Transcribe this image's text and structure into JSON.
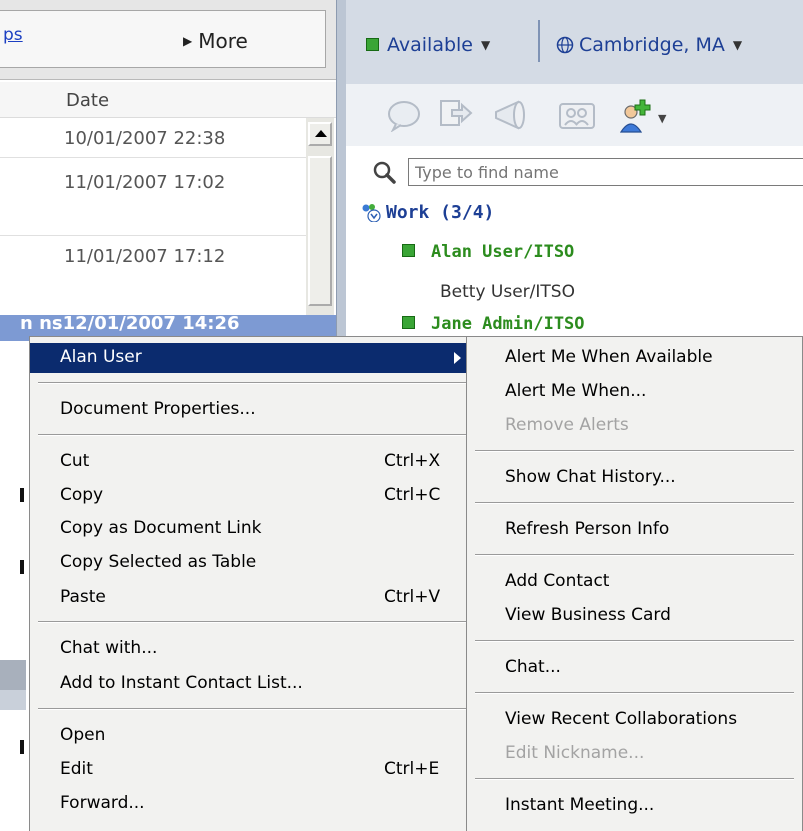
{
  "left_pane": {
    "toolbar_link": "ps",
    "more_label": "More",
    "column_header": "Date",
    "rows": [
      "10/01/2007 22:38",
      "11/01/2007 17:02",
      "11/01/2007 17:12"
    ],
    "selected_row": "n ns12/01/2007 14:26"
  },
  "right_pane": {
    "status": "Available",
    "location": "Cambridge, MA",
    "search_placeholder": "Type to find name",
    "group": "Work (3/4)",
    "contacts": [
      {
        "name": "Alan User/ITSO",
        "online": true
      },
      {
        "name": "Betty User/ITSO",
        "online": false
      },
      {
        "name": "Jane Admin/ITSO",
        "online": true
      }
    ],
    "status_color": "#3aa536"
  },
  "context_menu": {
    "header": "Alan User",
    "document_properties": "Document Properties...",
    "cut": "Cut",
    "cut_sc": "Ctrl+X",
    "copy": "Copy",
    "copy_sc": "Ctrl+C",
    "copy_doc_link": "Copy as Document Link",
    "copy_table": "Copy Selected as Table",
    "paste": "Paste",
    "paste_sc": "Ctrl+V",
    "chat_with": "Chat with...",
    "add_instant": "Add to Instant Contact List...",
    "open": "Open",
    "edit": "Edit",
    "edit_sc": "Ctrl+E",
    "forward": "Forward..."
  },
  "submenu": {
    "alert_available": "Alert Me When Available",
    "alert_when": "Alert Me When...",
    "remove_alerts": "Remove Alerts",
    "chat_history": "Show Chat History...",
    "refresh": "Refresh Person Info",
    "add_contact": "Add Contact",
    "business_card": "View Business Card",
    "chat": "Chat...",
    "recent_collab": "View Recent Collaborations",
    "edit_nickname": "Edit Nickname...",
    "instant_meeting": "Instant Meeting..."
  },
  "colors": {
    "menu_highlight": "#0b2b6e",
    "selection": "#7d9ad3",
    "online_green": "#2c8c1e"
  }
}
